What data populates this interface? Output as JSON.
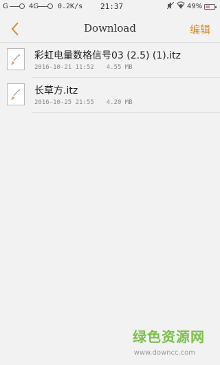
{
  "status_bar": {
    "signal_1": "G",
    "signal_2": "4G",
    "net_speed": "0.2K/s",
    "time": "21:37",
    "mute_icon": "mute-icon",
    "wifi_icon": "wifi-icon",
    "battery_percent": "49%",
    "battery_level": 0.49
  },
  "header": {
    "back_icon": "chevron-left-icon",
    "title": "Download",
    "edit_label": "编辑",
    "accent_color": "#e08a2a"
  },
  "files": [
    {
      "name": "彩虹电量数格信号03 (2.5) (1).itz",
      "date": "2016-10-21 11:52",
      "size": "4.55 MB",
      "icon": "theme-file-icon"
    },
    {
      "name": "长草方.itz",
      "date": "2016-10-25 21:55",
      "size": "4.20 MB",
      "icon": "theme-file-icon"
    }
  ],
  "watermark": {
    "brand": "绿色资源网",
    "url": "www.downcc.com"
  }
}
